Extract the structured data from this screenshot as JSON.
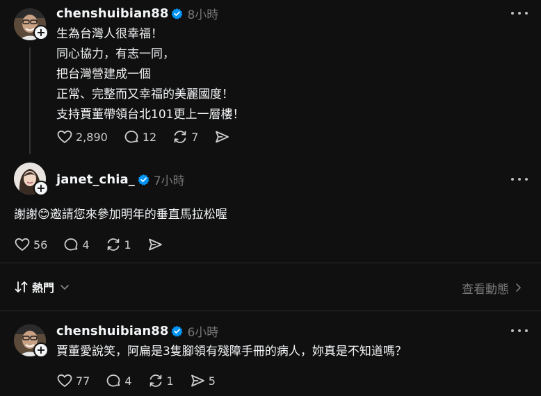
{
  "posts": [
    {
      "username": "chenshuibian88",
      "time": "8小時",
      "text": "生為台灣人很幸福！\n同心協力，有志一同，\n把台灣營建成一個\n正常、完整而又幸福的美麗國度！\n支持賈董帶領台北101更上一層樓！",
      "likes": "2,890",
      "replies": "12",
      "reposts": "7"
    },
    {
      "username": "janet_chia_",
      "time": "7小時",
      "text_before": "謝謝",
      "emoji": "😊",
      "text_after": "邀請您來參加明年的垂直馬拉松喔",
      "likes": "56",
      "replies": "4",
      "reposts": "1"
    },
    {
      "username": "chenshuibian88",
      "time": "6小時",
      "text": "賈董愛說笑，阿扁是3隻腳領有殘障手冊的病人，妳真是不知道嗎？",
      "likes": "77",
      "replies": "4",
      "reposts": "1",
      "shares": "5"
    }
  ],
  "sort": {
    "label": "熱門"
  },
  "activity_link": "查看動態",
  "colors": {
    "background": "#101010",
    "text": "#f3f5f7",
    "muted": "#777777",
    "verified": "#0095f6"
  },
  "icons": [
    "heart-icon",
    "comment-icon",
    "repost-icon",
    "share-icon",
    "more-icon",
    "verified-icon",
    "sort-icon",
    "chevron-down-icon",
    "chevron-right-icon",
    "plus-icon"
  ]
}
